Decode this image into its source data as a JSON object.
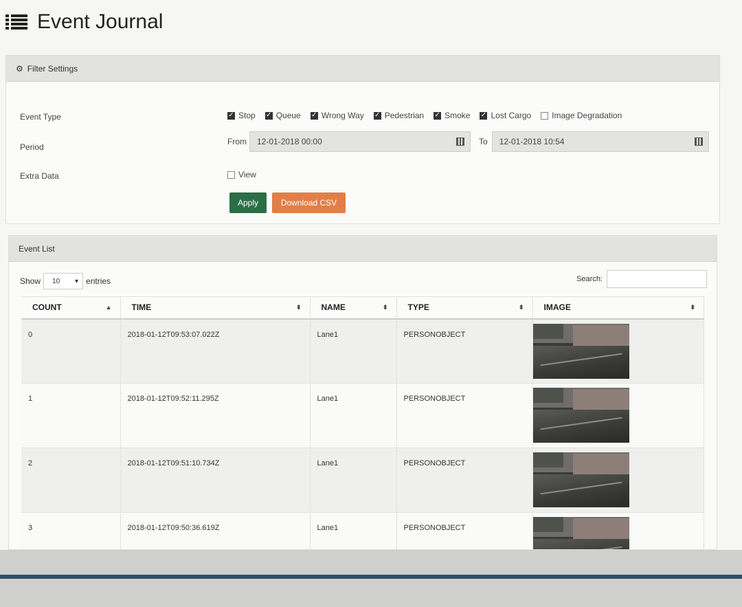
{
  "app": {
    "title": "Event Journal",
    "title_icon": "list-icon"
  },
  "filter": {
    "header": "Filter Settings",
    "header_icon": "gears-icon",
    "labels": {
      "event_type": "Event Type",
      "period": "Period",
      "extra_data": "Extra Data"
    },
    "event_types": [
      {
        "label": "Stop",
        "checked": true
      },
      {
        "label": "Queue",
        "checked": true
      },
      {
        "label": "Wrong Way",
        "checked": true
      },
      {
        "label": "Pedestrian",
        "checked": true
      },
      {
        "label": "Smoke",
        "checked": true
      },
      {
        "label": "Lost Cargo",
        "checked": true
      },
      {
        "label": "Image Degradation",
        "checked": false
      }
    ],
    "from_label": "From",
    "from_value": "12-01-2018 00:00",
    "to_label": "To",
    "to_value": "12-01-2018 10:54",
    "view_label": "View",
    "view_checked": false,
    "apply_label": "Apply",
    "csv_label": "Download CSV",
    "colors": {
      "apply": "#2b6e45",
      "csv": "#e07f4a"
    }
  },
  "events": {
    "header": "Event List",
    "show_label": "Show",
    "entries_value": "10",
    "entries_label": "entries",
    "search_label": "Search:",
    "columns": [
      "COUNT",
      "TIME",
      "NAME",
      "TYPE",
      "IMAGE"
    ],
    "rows": [
      {
        "count": "0",
        "time": "2018-01-12T09:53:07.022Z",
        "name": "Lane1",
        "type": "PERSONOBJECT"
      },
      {
        "count": "1",
        "time": "2018-01-12T09:52:11.295Z",
        "name": "Lane1",
        "type": "PERSONOBJECT"
      },
      {
        "count": "2",
        "time": "2018-01-12T09:51:10.734Z",
        "name": "Lane1",
        "type": "PERSONOBJECT"
      },
      {
        "count": "3",
        "time": "2018-01-12T09:50:36.619Z",
        "name": "Lane1",
        "type": "PERSONOBJECT"
      }
    ]
  }
}
